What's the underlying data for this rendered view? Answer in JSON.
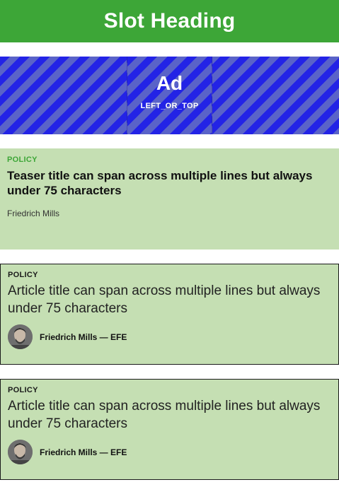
{
  "slot": {
    "heading": "Slot Heading"
  },
  "ad": {
    "title": "Ad",
    "slot_name": "LEFT_OR_TOP"
  },
  "teaser": {
    "kicker": "POLICY",
    "title": "Teaser title can span across multiple lines but always under 75 characters",
    "author": "Friedrich Mills"
  },
  "articles": [
    {
      "kicker": "POLICY",
      "title": "Article title can span across multiple lines but always under 75 characters",
      "byline": "Friedrich Mills — EFE"
    },
    {
      "kicker": "POLICY",
      "title": "Article title can span across multiple lines but always under 75 characters",
      "byline": "Friedrich Mills — EFE"
    }
  ],
  "colors": {
    "header_green": "#3da637",
    "card_green": "#c5dfb3",
    "ad_blue": "#2323e6",
    "ad_stripe": "#5a63c8"
  }
}
